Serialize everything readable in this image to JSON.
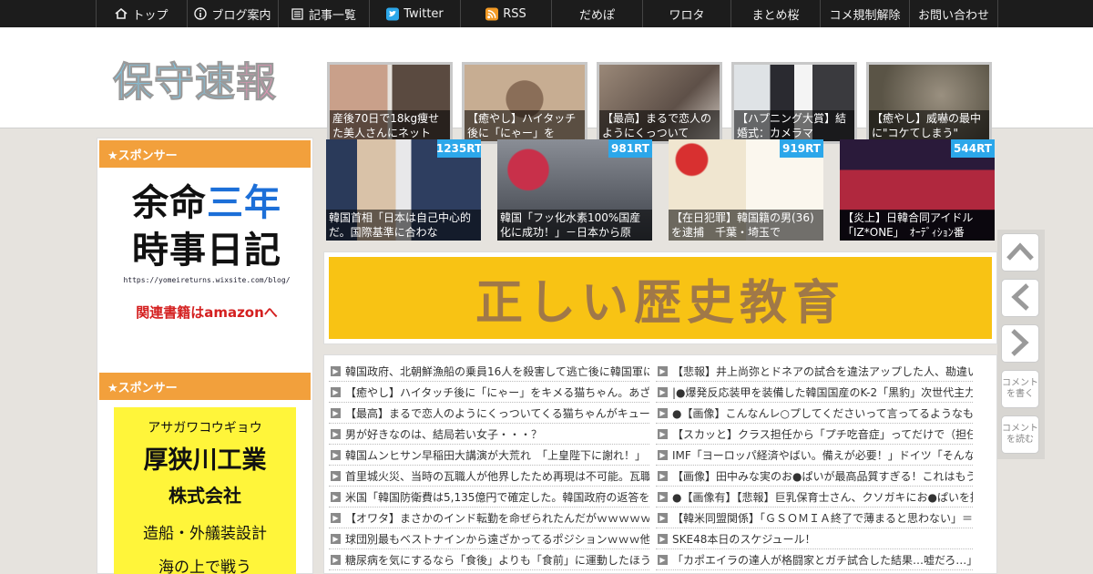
{
  "nav": {
    "items": [
      {
        "label": "トップ",
        "icon": "home-icon"
      },
      {
        "label": "ブログ案内",
        "icon": "info-icon"
      },
      {
        "label": "記事一覧",
        "icon": "list-icon"
      },
      {
        "label": "Twitter",
        "icon": "twitter-icon"
      },
      {
        "label": "RSS",
        "icon": "rss-icon"
      },
      {
        "label": "だめぽ",
        "icon": ""
      },
      {
        "label": "ワロタ",
        "icon": ""
      },
      {
        "label": "まとめ桜",
        "icon": ""
      },
      {
        "label": "コメ規制解除",
        "icon": ""
      },
      {
        "label": "お問い合わせ",
        "icon": ""
      }
    ]
  },
  "logo": {
    "chars": [
      "保",
      "守",
      "速",
      "報"
    ]
  },
  "header_thumbs": [
    {
      "caption": "産後70日で18kg痩せた美人さんにネット",
      "color": "#8a6a58"
    },
    {
      "caption": "【癒やし】ハイタッチ後に「にゃー」を",
      "color": "#b79a80"
    },
    {
      "caption": "【最高】まるで恋人のようにくっついて",
      "color": "#7b6a5e"
    },
    {
      "caption": "【ハプニング大賞】結婚式：カメラマ",
      "color": "#9aa0a4"
    },
    {
      "caption": "【癒やし】威嚇の最中に\"コケてしまう\"",
      "color": "#6e6654"
    }
  ],
  "sidebar": {
    "sponsor1": "★スポンサー",
    "ad1": {
      "line1a": "余命",
      "line1b": "三年",
      "line2": "時事日記",
      "url": "https://yomeireturns.wixsite.com/blog/",
      "link": "関連書籍はamazonへ"
    },
    "sponsor2": "★スポンサー",
    "ad2": {
      "kana": "アサガワコウギョウ",
      "name": "厚狭川工業",
      "corp": "株式会社",
      "desc": "造船・外艤装設計",
      "more": "海の上で戦う"
    }
  },
  "rt_items": [
    {
      "count": "1235RT",
      "caption": "韓国首相「日本は自己中心的だ。国際基準に合わな",
      "color": "#3a4a6a"
    },
    {
      "count": "981RT",
      "caption": "韓国「フッ化水素100%国産化に成功！」－日本から原",
      "color": "#5a5e66"
    },
    {
      "count": "919RT",
      "caption": "【在日犯罪】韓国籍の男(36)を逮捕　千葉・埼玉で",
      "color": "#e8dcc4"
    },
    {
      "count": "544RT",
      "caption": "【炎上】日韓合同アイドル「IZ*ONE」　ｵｰﾃﾞｨｼｮﾝ番",
      "color": "#4a2a3e"
    }
  ],
  "banner": {
    "text": "正しい歴史教育"
  },
  "news_left": [
    "韓国政府、北朝鮮漁船の乗員16人を殺害して逃亡後に韓国軍に",
    "【癒やし】ハイタッチ後に「にゃー」をキメる猫ちゃん。あざ",
    "【最高】まるで恋人のようにくっついてくる猫ちゃんがキュー",
    "男が好きなのは、結局若い女子・・・？",
    "韓国ムンヒサン早稲田大講演が大荒れ　「上皇陛下に謝れ！」",
    "首里城火災、当時の瓦職人が他界したため再現は不可能。瓦職",
    "米国「韓国防衛費は5,135億円で確定した。韓国政府の返答を待",
    "【オワタ】まさかのインド転勤を命ぜられたんだがｗｗｗｗｗ",
    "球団別最もベストナインから遠ざかってるポジションｗｗｗ他",
    "糖尿病を気にするなら「食後」よりも「食前」に運動したほう"
  ],
  "news_right": [
    "【悲報】井上尚弥とドネアの試合を違法アップした人、勘違い",
    "|●爆発反応装甲を装備した韓国国産のK-2「黒豹」次世代主力",
    "●【画像】こんなんレ○プしてくださいって言ってるようなも",
    "【スカッと】クラス担任から「プチ吃音症」ってだけで（担任",
    "IMF「ヨーロッパ経済やばい。備えが必要！」ドイツ「そんな",
    "【画像】田中みな実のお●ぱいが最高品質すぎる！これはもう",
    "●【画像有】【悲報】巨乳保育士さん、クソガキにお●ぱいを揉",
    "【韓米同盟関係】「ＧＳＯＭＩＡ終了で薄まると思わない」＝",
    "SKE48本日のスケジュール！",
    "「カポエイラの達人が格闘家とガチ試合した結果…嘘だろ…」"
  ],
  "side_buttons": {
    "write": "コメントを書く",
    "read": "コメントを読む"
  },
  "colors": {
    "nav_bg": "#1c1c1c",
    "sponsor_orange": "#f2a03c",
    "rt_blue": "#2ca7ea",
    "banner_yellow": "#f8c314"
  }
}
